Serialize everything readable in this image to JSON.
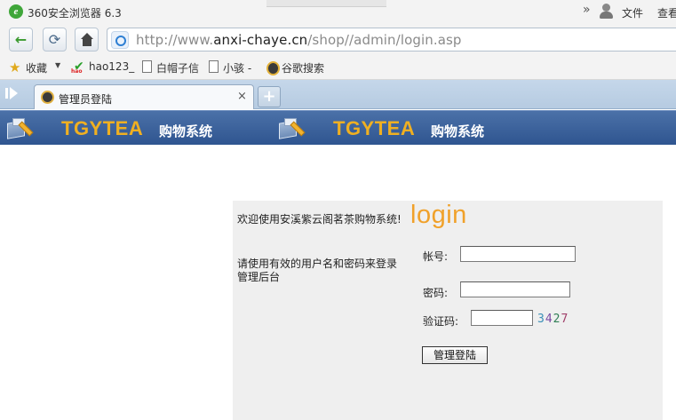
{
  "browser": {
    "title": "360安全浏览器 6.3",
    "menu": {
      "file": "文件",
      "view": "查看"
    },
    "url_prefix": "http://www.",
    "url_domain": "anxi-chaye.cn",
    "url_path": "/shop//admin/login.asp",
    "bookmarks": {
      "favorites": "收藏",
      "hao123": "hao123_",
      "baimaozixin": "白帽子信",
      "xiaohai": "小骇 -",
      "google_search": "谷歌搜索"
    },
    "tab": {
      "label": "管理员登陆",
      "close": "×"
    },
    "new_tab": "+"
  },
  "banner": {
    "brand": "TGYTEA",
    "subtitle": "购物系统"
  },
  "login": {
    "title": "login",
    "welcome": "欢迎使用安溪紫云阁茗茶购物系统!",
    "hint": "请使用有效的用户名和密码来登录管理后台",
    "username_label": "帐号:",
    "password_label": "密码:",
    "code_label": "验证码:",
    "username_value": "",
    "password_value": "",
    "code_value": "",
    "captcha": [
      "3",
      "4",
      "2",
      "7"
    ],
    "submit": "管理登陆"
  },
  "colors": {
    "banner_bg": "#3a619a",
    "brand": "#f0b021",
    "login_title": "#f0a12a",
    "panel_bg": "#efefef"
  }
}
